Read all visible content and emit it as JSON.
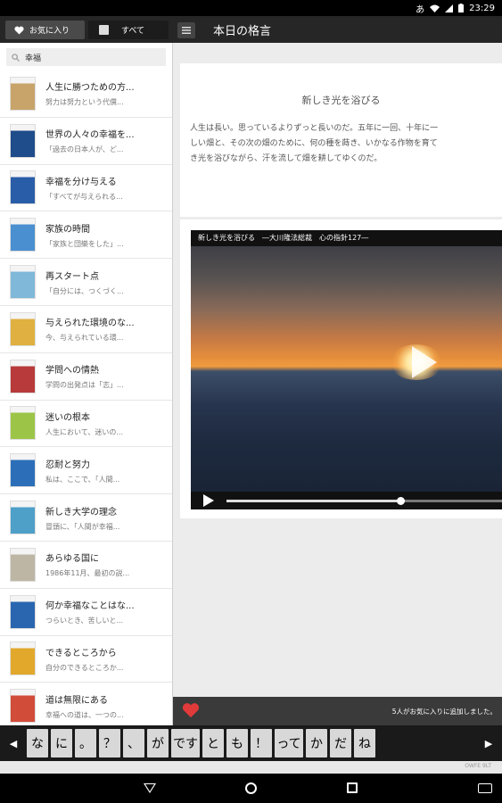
{
  "status_bar": {
    "ime": "あ",
    "time": "23:29"
  },
  "tabs": {
    "favorites": "お気に入り",
    "all": "すべて"
  },
  "title": "本日の格言",
  "search": {
    "value": "幸福"
  },
  "list": [
    {
      "title": "人生に勝つための方...",
      "sub": "努力は努力という代償...",
      "thumb_color": "#c8a46a"
    },
    {
      "title": "世界の人々の幸福を...",
      "sub": "「過去の日本人が、ど...",
      "thumb_color": "#1f4c8a"
    },
    {
      "title": "幸福を分け与える",
      "sub": "「すべてが与えられる...",
      "thumb_color": "#2a5da8"
    },
    {
      "title": "家族の時間",
      "sub": "「家族と団欒をした」...",
      "thumb_color": "#4a8fd0"
    },
    {
      "title": "再スタート点",
      "sub": "「自分には、つくづく...",
      "thumb_color": "#7fb8d8"
    },
    {
      "title": "与えられた環境のな...",
      "sub": "今、与えられている環...",
      "thumb_color": "#e0b040"
    },
    {
      "title": "学問への情熱",
      "sub": "学問の出発点は「志」...",
      "thumb_color": "#b83a3a"
    },
    {
      "title": "迷いの根本",
      "sub": "人生において、迷いの...",
      "thumb_color": "#9cc548"
    },
    {
      "title": "忍耐と努力",
      "sub": "私は、ここで、「人間...",
      "thumb_color": "#2c6fb8"
    },
    {
      "title": "新しき大学の理念",
      "sub": "冒頭に、「人間が幸福...",
      "thumb_color": "#4ea0c8"
    },
    {
      "title": "あらゆる国に",
      "sub": "1986年11月、最初の説...",
      "thumb_color": "#bdb6a4"
    },
    {
      "title": "何か幸福なことはな...",
      "sub": "つらいとき、苦しいと...",
      "thumb_color": "#2a66b0"
    },
    {
      "title": "できるところから",
      "sub": "自分のできるところか...",
      "thumb_color": "#e2a82c"
    },
    {
      "title": "道は無限にある",
      "sub": "幸福への道は、一つの...",
      "thumb_color": "#d24c3a"
    }
  ],
  "quote": {
    "heading": "新しき光を浴びる",
    "body": "人生は長い。思っているよりずっと長いのだ。五年に一回、十年に一\nしい畑と、その次の畑のために、何の種を蒔き、いかなる作物を育て\nき光を浴びながら、汗を流して畑を耕してゆくのだ。"
  },
  "video": {
    "title": "新しき光を浴びる　―大川隆法総裁　心の指針127―",
    "progress": 0.63
  },
  "favorite_bar": {
    "text": "5人がお気に入りに追加しました。",
    "heart_color": "#e03a3a"
  },
  "keyboard": {
    "keys": [
      "な",
      "に",
      "。",
      "？",
      "、",
      "が",
      "です",
      "と",
      "も",
      "！",
      "って",
      "か",
      "だ",
      "ね"
    ]
  },
  "keyboard_footer": "OWFE 9LT"
}
